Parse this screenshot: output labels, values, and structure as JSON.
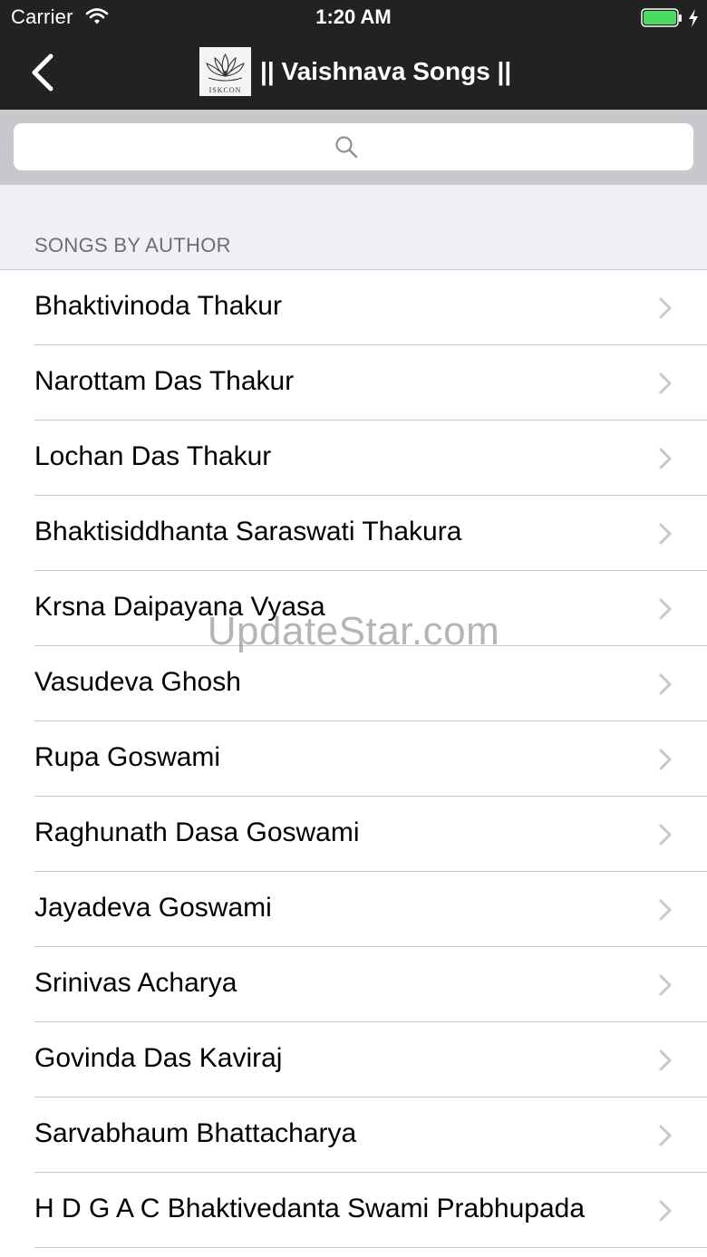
{
  "status_bar": {
    "carrier": "Carrier",
    "time": "1:20 AM",
    "battery_color": "#4cd964"
  },
  "nav": {
    "back_icon": "chevron-left-icon",
    "logo_text": "ISKCON",
    "title": "|| Vaishnava Songs ||"
  },
  "search": {
    "placeholder": "",
    "value": "",
    "icon": "search-icon"
  },
  "section": {
    "header": "SONGS BY AUTHOR"
  },
  "authors": [
    "Bhaktivinoda Thakur",
    "Narottam Das Thakur",
    "Lochan Das Thakur",
    "Bhaktisiddhanta Saraswati Thakura",
    "Krsna Daipayana Vyasa",
    "Vasudeva Ghosh",
    "Rupa Goswami",
    "Raghunath Dasa Goswami",
    "Jayadeva Goswami",
    "Srinivas Acharya",
    "Govinda Das Kaviraj",
    "Sarvabhaum Bhattacharya",
    "H D G A C Bhaktivedanta Swami Prabhupada"
  ],
  "watermark": "UpdateStar.com",
  "colors": {
    "nav_background": "#222222",
    "search_background": "#c8c7cc",
    "group_background": "#efeff4",
    "separator": "#c8c7cc",
    "chevron": "#c7c7cc"
  }
}
